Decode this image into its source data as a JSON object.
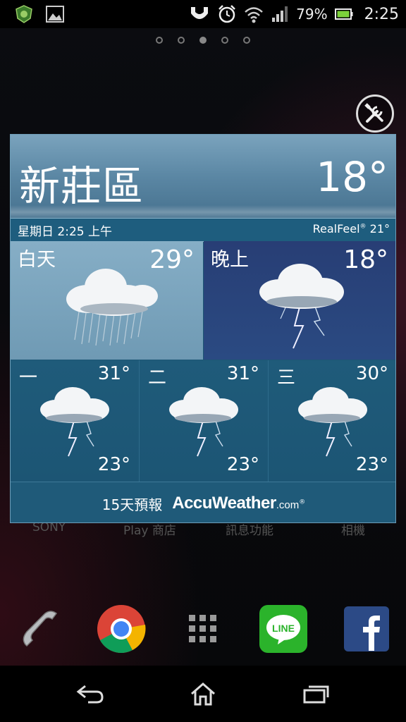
{
  "status_bar": {
    "battery_percent": "79%",
    "time": "2:25",
    "icons": [
      "app-shield-icon",
      "gallery-icon",
      "usb-icon",
      "alarm-icon",
      "wifi-icon",
      "signal-icon",
      "battery-icon"
    ]
  },
  "home": {
    "pages": 5,
    "active_page": 3,
    "app_labels": [
      "SONY",
      "Play 商店",
      "訊息功能",
      "相機"
    ],
    "dock": [
      "phone",
      "chrome",
      "app-drawer",
      "line",
      "facebook"
    ],
    "line_label": "LINE"
  },
  "widget": {
    "location": "新莊區",
    "current_temp": "18°",
    "date_time": "星期日 2:25 上午",
    "realfeel_label": "RealFeel",
    "realfeel_reg": "®",
    "realfeel_value": " 21°",
    "day": {
      "label": "白天",
      "temp": "29°",
      "icon": "cloud-rain-icon"
    },
    "night": {
      "label": "晚上",
      "temp": "18°",
      "icon": "cloud-thunder-icon"
    },
    "forecast": [
      {
        "name": "一",
        "high": "31°",
        "low": "23°",
        "icon": "cloud-thunder-icon"
      },
      {
        "name": "二",
        "high": "31°",
        "low": "23°",
        "icon": "cloud-thunder-icon"
      },
      {
        "name": "三",
        "high": "30°",
        "low": "23°",
        "icon": "cloud-thunder-icon"
      }
    ],
    "footer_text": "15天預報",
    "brand": "AccuWeather",
    "brand_domain": ".com",
    "brand_reg": "®"
  },
  "colors": {
    "widget_bg": "#1d5674",
    "night_bg": "#283e75",
    "day_bg": "#86aec6"
  }
}
